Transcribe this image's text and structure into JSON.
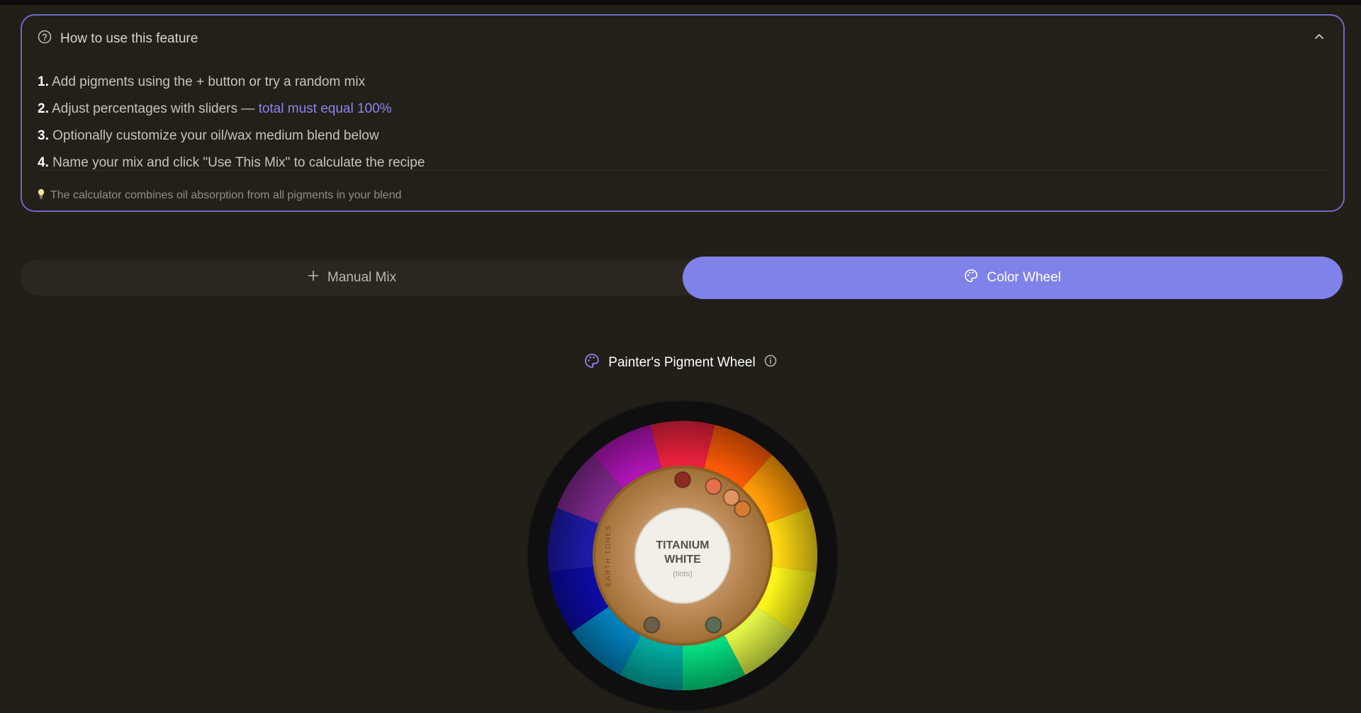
{
  "help": {
    "title": "How to use this feature",
    "steps": [
      {
        "num": "1.",
        "text": "Add pigments using the + button or try a random mix",
        "highlight": ""
      },
      {
        "num": "2.",
        "text": "Adjust percentages with sliders — ",
        "highlight": "total must equal 100%"
      },
      {
        "num": "3.",
        "text": "Optionally customize your oil/wax medium blend below",
        "highlight": ""
      },
      {
        "num": "4.",
        "text": "Name your mix and click \"Use This Mix\" to calculate the recipe",
        "highlight": ""
      }
    ],
    "tip": "The calculator combines oil absorption from all pigments in your blend"
  },
  "tabs": {
    "manual_label": "Manual Mix",
    "wheel_label": "Color Wheel",
    "active": "Color Wheel"
  },
  "wheel": {
    "title": "Painter's Pigment Wheel",
    "center_line1": "TITANIUM",
    "center_line2": "WHITE",
    "center_sub": "(tints)",
    "earth_label": "EARTH TONES",
    "segments": [
      "#e8213c",
      "#fa5a06",
      "#fe9c08",
      "#fed812",
      "#fcf51b",
      "#e1f447",
      "#04db7f",
      "#02a99f",
      "#0281bc",
      "#0c0ba2",
      "#1d1aa8",
      "#80288e",
      "#ad14b3"
    ],
    "earth_swatches": [
      "#8f2a21",
      "#e6704c",
      "#e19363",
      "#d77b32",
      "#6b5e4b",
      "#5a6c54"
    ]
  },
  "colors": {
    "accent": "#7f82e8",
    "accent_text": "#8a86f0",
    "panel_border": "#6f69c6",
    "background": "#221e18"
  }
}
